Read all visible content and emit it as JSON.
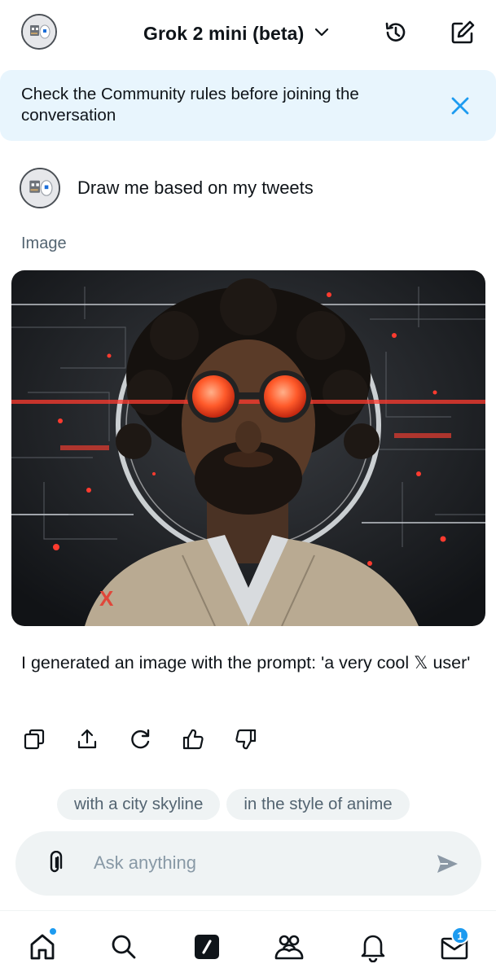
{
  "header": {
    "model_title": "Grok 2 mini (beta)",
    "icons": {
      "avatar": "grok-avatar-icon",
      "dropdown": "chevron-down-icon",
      "history": "history-icon",
      "new_chat": "compose-icon"
    }
  },
  "banner": {
    "text": "Check the Community rules before joining the conversation",
    "close_icon": "close-icon"
  },
  "conversation": {
    "user_message": "Draw me based on my tweets",
    "image_label": "Image",
    "response_text": "I generated an image with the prompt: 'a very cool 𝕏 user'",
    "actions": [
      "copy-icon",
      "share-icon",
      "regenerate-icon",
      "thumbs-up-icon",
      "thumbs-down-icon"
    ]
  },
  "suggestions": [
    "with a city skyline",
    "in the style of anime"
  ],
  "input": {
    "placeholder": "Ask anything",
    "attach_icon": "paperclip-icon",
    "send_icon": "send-icon"
  },
  "bottom_nav": {
    "items": [
      "home-icon",
      "search-icon",
      "grok-icon",
      "communities-icon",
      "notifications-icon",
      "messages-icon"
    ],
    "messages_badge": "1"
  },
  "colors": {
    "accent": "#1d9bf0",
    "banner_bg": "#e8f5fd",
    "chip_bg": "#eff3f4",
    "muted_text": "#536471"
  }
}
